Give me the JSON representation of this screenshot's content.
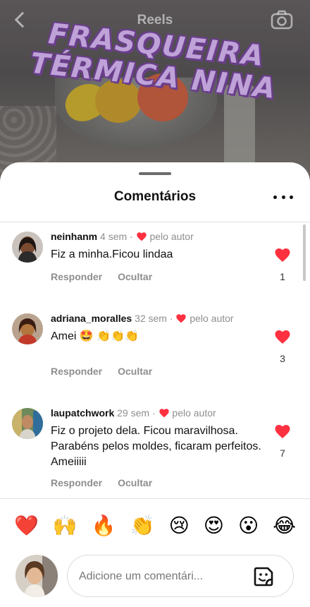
{
  "header": {
    "title": "Reels",
    "overlay_line1": "FRASQUEIRA",
    "overlay_line2": "TÉRMICA NINA"
  },
  "sheet": {
    "title": "Comentários",
    "more_icon": "more-horizontal-icon"
  },
  "comments": [
    {
      "username": "neinhanm",
      "time": "4 sem",
      "author_like": "pelo autor",
      "text": "Fiz a minha.Ficou lindaa",
      "reply": "Responder",
      "hide": "Ocultar",
      "likes": "1"
    },
    {
      "username": "adriana_moralles",
      "time": "32 sem",
      "author_like": "pelo autor",
      "text": "Amei 🤩 👏👏👏",
      "reply": "Responder",
      "hide": "Ocultar",
      "likes": "3"
    },
    {
      "username": "laupatchwork",
      "time": "29 sem",
      "author_like": "pelo autor",
      "text": "Fiz o projeto dela. Ficou maravilhosa. Parabéns pelos moldes, ficaram perfeitos. Ameiiiii",
      "reply": "Responder",
      "hide": "Ocultar",
      "likes": "7"
    }
  ],
  "emoji_bar": [
    "❤️",
    "🙌",
    "🔥",
    "👏",
    "😢",
    "😍",
    "😮",
    "😂"
  ],
  "input": {
    "placeholder": "Adicione um comentári...",
    "value": ""
  },
  "colors": {
    "like_red": "#ff3040",
    "muted_text": "#8e8e8e"
  }
}
